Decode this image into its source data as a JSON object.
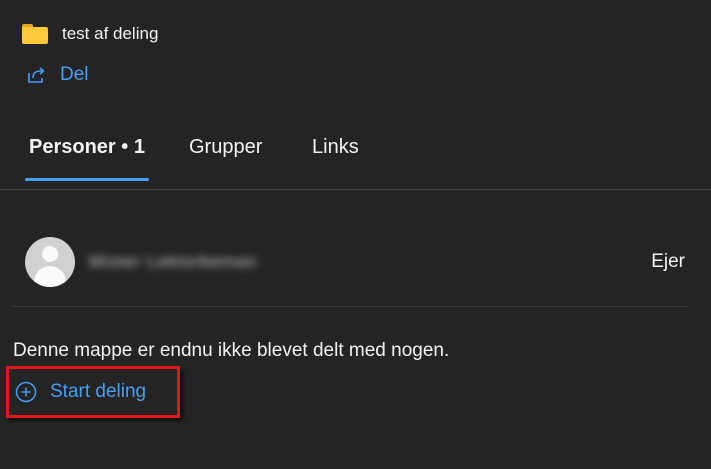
{
  "folder": {
    "name": "test af deling",
    "icon": "folder-icon"
  },
  "share": {
    "label": "Del",
    "icon": "share-icon"
  },
  "tabs": [
    {
      "label": "Personer • 1",
      "active": true
    },
    {
      "label": "Grupper",
      "active": false
    },
    {
      "label": "Links",
      "active": false
    }
  ],
  "person": {
    "name": "Mister Lektorbeman",
    "role": "Ejer",
    "avatar": "default-avatar"
  },
  "empty_message": "Denne mappe er endnu ikke blevet delt med nogen.",
  "start_share": {
    "label": "Start deling",
    "icon": "plus-circle-icon"
  },
  "colors": {
    "background": "#242424",
    "accent": "#479ef5",
    "highlight_box": "#e0161d",
    "folder": "#ffc83d"
  }
}
